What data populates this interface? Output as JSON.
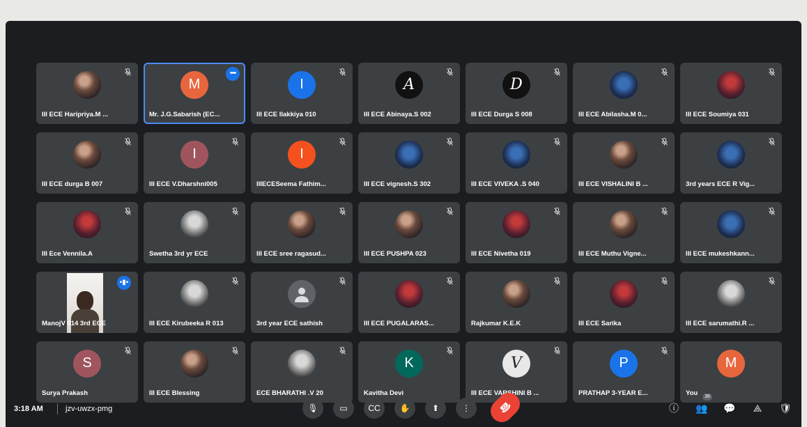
{
  "meeting": {
    "time": "3:18 AM",
    "code": "jzv-uwzx-pmg",
    "participant_count": "36"
  },
  "icons": {
    "mute": "mic-off-icon",
    "more": "more-options-icon",
    "speaking": "speaking-indicator-icon"
  },
  "colors": {
    "accent": "#1a73e8",
    "end_call": "#ea4335",
    "tile": "#3c4043",
    "background": "#1b1d21"
  },
  "tiles": [
    {
      "name": "III ECE Haripriya.M ...",
      "avatar": "photo",
      "initial": ""
    },
    {
      "name": "Mr. J.G.Sabarish (EC...",
      "avatar": "letter",
      "initial": "M",
      "color": "#e8663d",
      "active": true
    },
    {
      "name": "III ECE Ilakkiya 010",
      "avatar": "letter",
      "initial": "I",
      "color": "#1a73e8"
    },
    {
      "name": "III ECE Abinaya.S 002",
      "avatar": "script",
      "initial": "A"
    },
    {
      "name": "III ECE Durga S 008",
      "avatar": "script",
      "initial": "D"
    },
    {
      "name": "III ECE Abilasha.M 0...",
      "avatar": "photo3",
      "initial": ""
    },
    {
      "name": "III ECE Soumiya 031",
      "avatar": "photo4",
      "initial": ""
    },
    {
      "name": "III ECE durga B 007",
      "avatar": "photo",
      "initial": ""
    },
    {
      "name": "III ECE V.Dharshni005",
      "avatar": "letter",
      "initial": "I",
      "color": "#a0555e"
    },
    {
      "name": "IIIECESeema Fathim...",
      "avatar": "letter",
      "initial": "I",
      "color": "#f4511e"
    },
    {
      "name": "III ECE vignesh.S 302",
      "avatar": "photo3",
      "initial": ""
    },
    {
      "name": "III ECE VIVEKA .S 040",
      "avatar": "photo3",
      "initial": ""
    },
    {
      "name": "III ECE VISHALINI B ...",
      "avatar": "photo",
      "initial": ""
    },
    {
      "name": "3rd years ECE R Vig...",
      "avatar": "photo3",
      "initial": ""
    },
    {
      "name": "III Ece Vennila.A",
      "avatar": "photo4",
      "initial": ""
    },
    {
      "name": "Swetha 3rd yr ECE",
      "avatar": "photo2",
      "initial": ""
    },
    {
      "name": "III ECE sree ragasud...",
      "avatar": "photo",
      "initial": ""
    },
    {
      "name": "III ECE PUSHPA 023",
      "avatar": "photo",
      "initial": ""
    },
    {
      "name": "III ECE Nivetha 019",
      "avatar": "photo4",
      "initial": ""
    },
    {
      "name": "III ECE Muthu Vigne...",
      "avatar": "photo",
      "initial": ""
    },
    {
      "name": "III ECE mukeshkann...",
      "avatar": "photo3",
      "initial": ""
    },
    {
      "name": "ManojV 014 3rd ECE",
      "avatar": "video",
      "initial": "",
      "speaking": true
    },
    {
      "name": "III ECE Kirubeeka R 013",
      "avatar": "photo2",
      "initial": ""
    },
    {
      "name": "3rd year ECE sathish",
      "avatar": "person",
      "initial": ""
    },
    {
      "name": "III ECE PUGALARAS...",
      "avatar": "photo4",
      "initial": ""
    },
    {
      "name": "Rajkumar K.E.K",
      "avatar": "photo",
      "initial": ""
    },
    {
      "name": "III ECE Sarika",
      "avatar": "photo4",
      "initial": ""
    },
    {
      "name": "III ECE sarumathi.R ...",
      "avatar": "photo2",
      "initial": ""
    },
    {
      "name": "Surya Prakash",
      "avatar": "letter",
      "initial": "S",
      "color": "#a0555e"
    },
    {
      "name": "III ECE Blessing",
      "avatar": "photo",
      "initial": ""
    },
    {
      "name": "ECE BHARATHI .V 20",
      "avatar": "photo2",
      "initial": ""
    },
    {
      "name": "Kavitha Devi",
      "avatar": "letter",
      "initial": "K",
      "color": "#00695c"
    },
    {
      "name": "III ECE VARSHINI B ...",
      "avatar": "script-light",
      "initial": "V"
    },
    {
      "name": "PRATHAP 3-YEAR E...",
      "avatar": "letter",
      "initial": "P",
      "color": "#1a73e8"
    },
    {
      "name": "You",
      "avatar": "letter",
      "initial": "M",
      "color": "#e8663d",
      "self": true
    }
  ],
  "controls": [
    {
      "id": "mic",
      "icon": "microphone-icon",
      "glyph": "🎙"
    },
    {
      "id": "camera",
      "icon": "camera-icon",
      "glyph": "▭"
    },
    {
      "id": "captions",
      "icon": "captions-icon",
      "glyph": "CC"
    },
    {
      "id": "raise-hand",
      "icon": "raise-hand-icon",
      "glyph": "✋"
    },
    {
      "id": "present",
      "icon": "present-screen-icon",
      "glyph": "⬆"
    },
    {
      "id": "more",
      "icon": "more-vert-icon",
      "glyph": "⋮"
    },
    {
      "id": "end-call",
      "icon": "end-call-icon",
      "glyph": "☎"
    }
  ],
  "right_controls": [
    {
      "id": "info",
      "icon": "info-icon",
      "glyph": "ⓘ"
    },
    {
      "id": "people",
      "icon": "people-icon",
      "glyph": "👥"
    },
    {
      "id": "chat",
      "icon": "chat-icon",
      "glyph": "💬"
    },
    {
      "id": "activities",
      "icon": "activities-icon",
      "glyph": "⟁"
    },
    {
      "id": "host-controls",
      "icon": "host-controls-icon",
      "glyph": "🛡"
    }
  ]
}
